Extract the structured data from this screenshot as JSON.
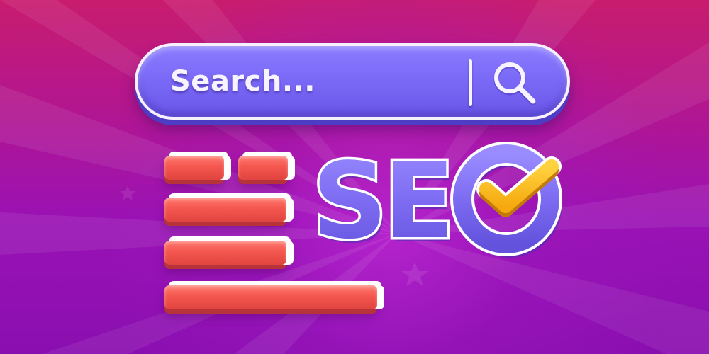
{
  "search": {
    "placeholder": "Search...",
    "icon": "magnifier-icon"
  },
  "logo": {
    "text": "SEO",
    "check_icon": "checkmark-icon"
  },
  "colors": {
    "background_top": "#c81c6e",
    "background_bottom": "#8a0fb0",
    "search_bar": "#7b6af7",
    "bars": "#f4574f",
    "seo_letters": "#7d6cf2",
    "checkmark": "#ffc21a"
  },
  "text_lines": [
    {
      "segments": 2
    },
    {
      "segments": 1
    },
    {
      "segments": 1
    },
    {
      "segments": 1
    }
  ]
}
